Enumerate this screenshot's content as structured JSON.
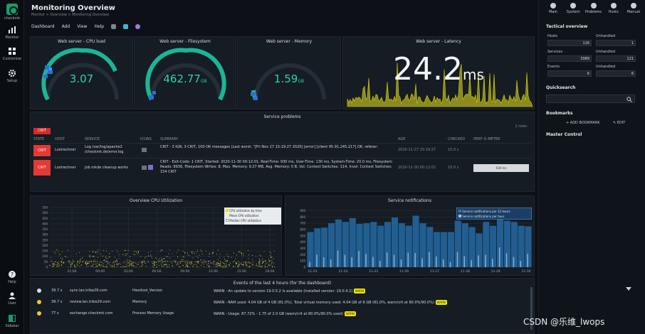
{
  "nav": {
    "brand": "checkmk",
    "items": [
      {
        "label": "Monitor",
        "icon": "bar-chart-icon"
      },
      {
        "label": "Customize",
        "icon": "grid-icon"
      },
      {
        "label": "Setup",
        "icon": "gear-icon"
      }
    ],
    "bottom": [
      {
        "label": "Help",
        "icon": "help-icon"
      },
      {
        "label": "User",
        "icon": "user-icon"
      },
      {
        "label": "Sidebar",
        "icon": "sidebar-icon"
      }
    ]
  },
  "header": {
    "title": "Monitoring Overview",
    "breadcrumb": "Monitor > Overview > Monitoring Overview",
    "menu": [
      "Dashboard",
      "Add",
      "View",
      "Help"
    ]
  },
  "gauges": [
    {
      "title": "Web server - CPU load",
      "value": "3.07",
      "unit": "",
      "fraction": 0.45
    },
    {
      "title": "Web server - Filesystem",
      "value": "462.77",
      "unit": "GB",
      "fraction": 0.5
    },
    {
      "title": "Web server - Memory",
      "value": "1.59",
      "unit": "GB",
      "fraction": 0.08
    }
  ],
  "latency": {
    "title": "Web server - Latency",
    "value": "24.2",
    "unit": "ms"
  },
  "problems": {
    "title": "Service problems",
    "rows_label": "2 rows",
    "crit_tag": "CRIT",
    "columns": [
      "STATE",
      "HOST",
      "SERVICE",
      "ICONS",
      "SUMMARY",
      "AGE",
      "CHECKED",
      "PERF-O-METER"
    ],
    "rows": [
      {
        "state": "CRIT",
        "host": "Lostrechner",
        "service": "Log /var/log/apache2 /checkmk.de/error.log",
        "summary": "CRIT - 3 IGN, 3 CRIT, 100 OK messages (Last worst: \"[Fri Nov 27 15:19:27 2020] [error] [client 95.91.245.217] OK, referer:",
        "age": "2020-11-27 15:19:27",
        "checked": "15.0 s",
        "perf": ""
      },
      {
        "state": "CRIT",
        "host": "Lostrechner",
        "service": "Job mkde cleanup works",
        "summary": "CRIT - Exit-Code: 1 CRIT, Started: 2020-11-30 00:12:01, Real-Time: 930 ms, User-Time: 130 ms, System-Time: 20.0 ms, Filesystem Reads: 8936, Filesystem Writes: 8, Max. Memory: 9.27 MB, Avg. Memory: 0 B, Vol. Context Switches: 114, Invol. Context Switches: 154 CRIT",
        "age": "2020-11-30 00:12:02",
        "checked": "15.0 s",
        "perf": "930 ms"
      }
    ]
  },
  "cpu_chart": {
    "title": "Overview CPU Utilization",
    "legend": [
      "CPU utilization by time",
      "Mean CPU utilization",
      "Median CPU utilization"
    ],
    "chart_data": {
      "type": "scatter",
      "yticks": [
        0,
        50,
        100,
        150,
        200,
        250,
        300,
        350,
        400,
        450,
        500,
        550
      ],
      "xticks": [
        "21:00",
        "00:00",
        "03:00",
        "06:00",
        "09:00",
        "12:00",
        "15:00",
        "18:00"
      ],
      "ylim": [
        0,
        550
      ]
    }
  },
  "notif_chart": {
    "title": "Service notifications",
    "legend": [
      "Service notifications per 12 hours",
      "Service notifications per hour"
    ],
    "chart_data": {
      "type": "bar",
      "yticks": [
        0,
        100,
        200,
        300,
        400,
        500,
        600,
        700,
        800,
        900
      ],
      "xticks": [
        "11-23",
        "11-24",
        "11-25",
        "11-26",
        "11-27",
        "11-28",
        "11-29",
        "11-30"
      ],
      "ylim": [
        0,
        950
      ],
      "values": [
        560,
        620,
        630,
        700,
        760,
        720,
        780,
        690,
        700,
        720,
        660,
        720,
        790,
        700,
        660,
        820,
        700,
        640,
        560,
        560,
        560,
        740,
        700,
        640,
        540,
        720,
        660,
        840,
        740,
        720,
        660,
        650
      ]
    }
  },
  "events": {
    "title": "Events of the last 4 hours (for the dashboard)",
    "rows": [
      {
        "age": "39.7 s",
        "host": "sync.lan.tribe29.com",
        "service": "Hwsitool_Version",
        "text": "WARN - An update to version 19.0.5.2 is available (installed version: 19.0.4.2)",
        "pill": "WARN",
        "color": "#d8dde2"
      },
      {
        "age": "39.7 s",
        "host": "review.lan.tribe29.com",
        "service": "Memory",
        "text": "WARN - RAM used: 4.04 GB of 4 GB (81.0%), Total virtual memory used: 4.04 GB of 6 GB (81.0%, warn/crit at 80.0%/90.0%)",
        "pill": "WARN",
        "color": "#f4c531"
      },
      {
        "age": "77 s",
        "host": "exchange.checkmk.com",
        "service": "Process Memory Usage",
        "text": "WARN - Usage: 87.72% - 1.75 of 2.0 GB (warn/crit at 80.0%/90.0% used)",
        "pill": "WARN",
        "color": "#f4c531"
      }
    ]
  },
  "sidebar": {
    "top": [
      "Main",
      "System",
      "Problems",
      "Hosts",
      "Manual"
    ],
    "tactical_title": "Tactical overview",
    "tactical": [
      {
        "label": "Hosts",
        "value": "116",
        "label2": "Unhandled",
        "value2": "1"
      },
      {
        "label": "Services",
        "value": "3989",
        "label2": "Unhandled",
        "value2": "121"
      },
      {
        "label": "Events",
        "value": "6",
        "label2": "Unhandled",
        "value2": "6"
      }
    ],
    "quicksearch_title": "Quicksearch",
    "bookmarks_title": "Bookmarks",
    "add_bookmark": "ADD BOOKMARK",
    "edit": "EDIT",
    "master_title": "Master Control"
  },
  "watermark": "CSDN @乐维_lwops"
}
